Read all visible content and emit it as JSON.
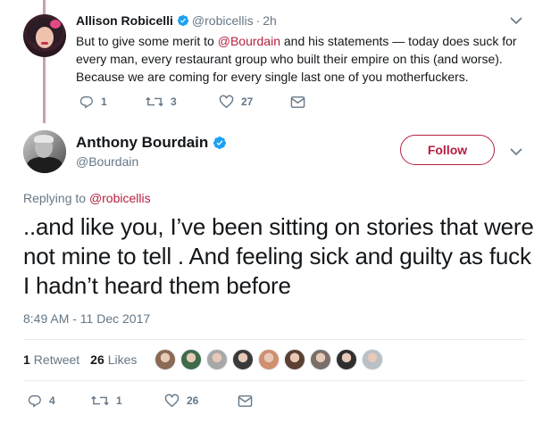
{
  "colors": {
    "accent": "#b5203f",
    "secondary_text": "#657786",
    "primary_text": "#14171a",
    "verified": "#1da1f2"
  },
  "parent_tweet": {
    "name": "Allison Robicelli",
    "handle": "@robicellis",
    "time": "2h",
    "text_before": "But to give some merit to ",
    "mention": "@Bourdain",
    "text_after": " and his statements — today does suck for every man, every restaurant group who built their empire on this (and worse). Because we are coming for every single last one of you motherfuckers.",
    "actions": {
      "replies": "1",
      "retweets": "3",
      "likes": "27"
    }
  },
  "main_tweet": {
    "name": "Anthony Bourdain",
    "handle": "@Bourdain",
    "follow_label": "Follow",
    "replying_prefix": "Replying to ",
    "replying_to": "@robicellis",
    "text": "..and like you, I’ve been sitting on stories that were not mine to tell . And feeling sick and guilty as fuck I hadn’t heard them before",
    "timestamp": "8:49 AM - 11 Dec 2017",
    "stats": {
      "retweets_count": "1",
      "retweets_label": "Retweet",
      "likes_count": "26",
      "likes_label": "Likes"
    },
    "likers": [
      "#8b6a55",
      "#3f6b4a",
      "#a8a8a8",
      "#3a3a3a",
      "#d18f6f",
      "#5a3f33",
      "#7b6f6a",
      "#2f2f2f",
      "#b9c0c6"
    ],
    "actions": {
      "replies": "4",
      "retweets": "1",
      "likes": "26"
    }
  }
}
